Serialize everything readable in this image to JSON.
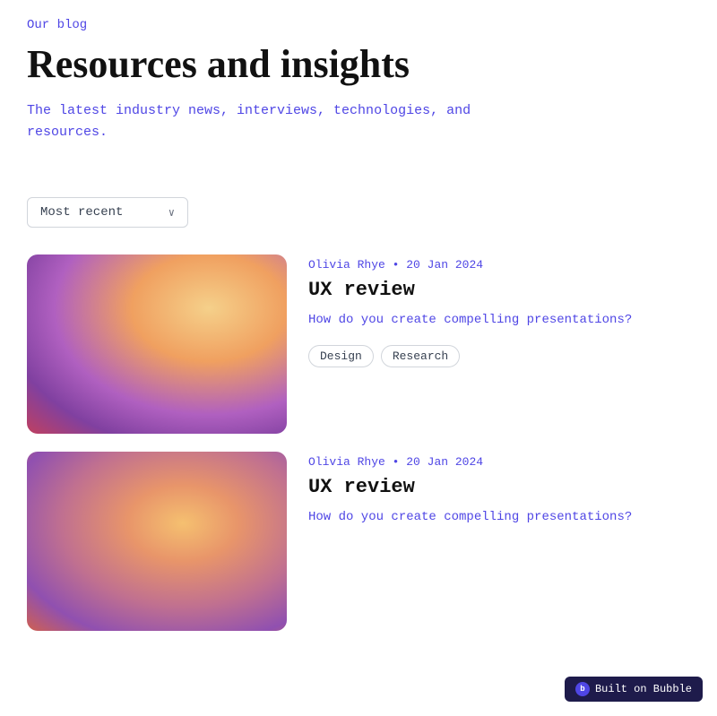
{
  "header": {
    "blog_label": "Our blog",
    "title": "Resources and insights",
    "subtitle": "The latest industry news, interviews, technologies, and resources."
  },
  "filter": {
    "sort_label": "Most recent",
    "chevron": "∨"
  },
  "articles": [
    {
      "author": "Olivia Rhye",
      "date": "20 Jan 2024",
      "title": "UX review",
      "excerpt": "How do you create compelling presentations?",
      "tags": [
        "Design",
        "Research"
      ],
      "gradient_class": "gradient-1"
    },
    {
      "author": "Olivia Rhye",
      "date": "20 Jan 2024",
      "title": "UX review",
      "excerpt": "How do you create compelling presentations?",
      "tags": [],
      "gradient_class": "gradient-2"
    }
  ],
  "bubble_badge": {
    "icon": "b",
    "label": "Built on Bubble"
  }
}
